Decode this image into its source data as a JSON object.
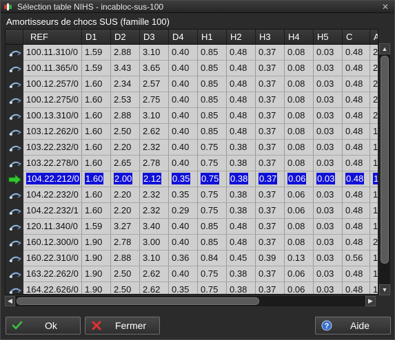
{
  "window": {
    "title": "Sélection table NIHS - incabloc-sus-100",
    "close_symbol": "✕"
  },
  "subtitle": "Amortisseurs de chocs SUS (famille 100)",
  "columns": [
    "REF",
    "D1",
    "D2",
    "D3",
    "D4",
    "H1",
    "H2",
    "H3",
    "H4",
    "H5",
    "C",
    "A"
  ],
  "rows": [
    {
      "icon": "shock-absorber-icon",
      "cells": [
        "100.11.310/0",
        "1.59",
        "2.88",
        "3.10",
        "0.40",
        "0.85",
        "0.48",
        "0.37",
        "0.08",
        "0.03",
        "0.48",
        "2"
      ]
    },
    {
      "icon": "shock-absorber-icon",
      "cells": [
        "100.11.365/0",
        "1.59",
        "3.43",
        "3.65",
        "0.40",
        "0.85",
        "0.48",
        "0.37",
        "0.08",
        "0.03",
        "0.48",
        "2"
      ]
    },
    {
      "icon": "shock-absorber-icon",
      "cells": [
        "100.12.257/0",
        "1.60",
        "2.34",
        "2.57",
        "0.40",
        "0.85",
        "0.48",
        "0.37",
        "0.08",
        "0.03",
        "0.48",
        "2"
      ]
    },
    {
      "icon": "shock-absorber-icon",
      "cells": [
        "100.12.275/0",
        "1.60",
        "2.53",
        "2.75",
        "0.40",
        "0.85",
        "0.48",
        "0.37",
        "0.08",
        "0.03",
        "0.48",
        "2"
      ]
    },
    {
      "icon": "shock-absorber-icon",
      "cells": [
        "100.13.310/0",
        "1.60",
        "2.88",
        "3.10",
        "0.40",
        "0.85",
        "0.48",
        "0.37",
        "0.08",
        "0.03",
        "0.48",
        "2"
      ]
    },
    {
      "icon": "shock-absorber-icon",
      "cells": [
        "103.12.262/0",
        "1.60",
        "2.50",
        "2.62",
        "0.40",
        "0.85",
        "0.48",
        "0.37",
        "0.08",
        "0.03",
        "0.48",
        "1"
      ]
    },
    {
      "icon": "shock-absorber-icon",
      "cells": [
        "103.22.232/0",
        "1.60",
        "2.20",
        "2.32",
        "0.40",
        "0.75",
        "0.38",
        "0.37",
        "0.08",
        "0.03",
        "0.48",
        "1"
      ]
    },
    {
      "icon": "shock-absorber-icon",
      "cells": [
        "103.22.278/0",
        "1.60",
        "2.65",
        "2.78",
        "0.40",
        "0.75",
        "0.38",
        "0.37",
        "0.08",
        "0.03",
        "0.48",
        "1"
      ]
    },
    {
      "icon": "arrow-right-icon",
      "selected": true,
      "cells": [
        "104.22.212/0",
        "1.60",
        "2.00",
        "2.12",
        "0.35",
        "0.75",
        "0.38",
        "0.37",
        "0.06",
        "0.03",
        "0.48",
        "1"
      ]
    },
    {
      "icon": "shock-absorber-icon",
      "cells": [
        "104.22.232/0",
        "1.60",
        "2.20",
        "2.32",
        "0.35",
        "0.75",
        "0.38",
        "0.37",
        "0.06",
        "0.03",
        "0.48",
        "1"
      ]
    },
    {
      "icon": "shock-absorber-icon",
      "cells": [
        "104.22.232/1",
        "1.60",
        "2.20",
        "2.32",
        "0.29",
        "0.75",
        "0.38",
        "0.37",
        "0.06",
        "0.03",
        "0.48",
        "1"
      ]
    },
    {
      "icon": "shock-absorber-icon",
      "cells": [
        "120.11.340/0",
        "1.59",
        "3.27",
        "3.40",
        "0.40",
        "0.85",
        "0.48",
        "0.37",
        "0.08",
        "0.03",
        "0.48",
        "1"
      ]
    },
    {
      "icon": "shock-absorber-icon",
      "cells": [
        "160.12.300/0",
        "1.90",
        "2.78",
        "3.00",
        "0.40",
        "0.85",
        "0.48",
        "0.37",
        "0.08",
        "0.03",
        "0.48",
        "2"
      ]
    },
    {
      "icon": "shock-absorber-icon",
      "cells": [
        "160.22.310/0",
        "1.90",
        "2.88",
        "3.10",
        "0.36",
        "0.84",
        "0.45",
        "0.39",
        "0.13",
        "0.03",
        "0.56",
        "1"
      ]
    },
    {
      "icon": "shock-absorber-icon",
      "cells": [
        "163.22.262/0",
        "1.90",
        "2.50",
        "2.62",
        "0.40",
        "0.75",
        "0.38",
        "0.37",
        "0.06",
        "0.03",
        "0.48",
        "1"
      ]
    },
    {
      "icon": "shock-absorber-icon",
      "cells": [
        "164.22.626/0",
        "1.90",
        "2.50",
        "2.62",
        "0.35",
        "0.75",
        "0.38",
        "0.37",
        "0.06",
        "0.03",
        "0.48",
        "1"
      ]
    }
  ],
  "buttons": {
    "ok": "Ok",
    "fermer": "Fermer",
    "aide": "Aide"
  },
  "scroll": {
    "vertical_up": "▲",
    "vertical_down": "▼",
    "horizontal_left": "◀",
    "horizontal_right": "▶"
  }
}
